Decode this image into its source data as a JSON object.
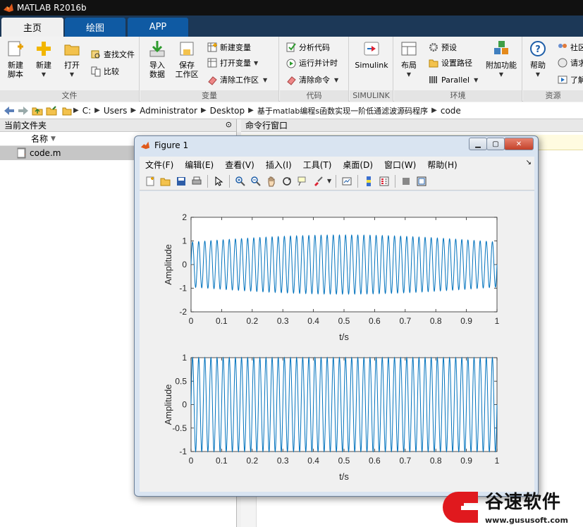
{
  "app": {
    "title": "MATLAB R2016b"
  },
  "tabs": [
    {
      "label": "主页"
    },
    {
      "label": "绘图"
    },
    {
      "label": "APP"
    }
  ],
  "ribbon": {
    "file": {
      "label": "文件",
      "new_script": "新建\n脚本",
      "new": "新建",
      "open": "打开",
      "find_files": "查找文件",
      "compare": "比较"
    },
    "variable": {
      "label": "变量",
      "import": "导入\n数据",
      "save": "保存\n工作区",
      "new_var": "新建变量",
      "open_var": "打开变量",
      "clear_ws": "清除工作区"
    },
    "code": {
      "label": "代码",
      "analyze": "分析代码",
      "run_time": "运行并计时",
      "clear_cmd": "清除命令"
    },
    "simulink": {
      "label": "SIMULINK",
      "simulink": "Simulink"
    },
    "env": {
      "label": "环境",
      "layout": "布局",
      "prefs": "预设",
      "set_path": "设置路径",
      "parallel": "Parallel",
      "addons": "附加功能"
    },
    "res": {
      "label": "资源",
      "help": "帮助",
      "community": "社区",
      "request": "请求",
      "learn": "了解"
    }
  },
  "address": {
    "crumbs": [
      "C:",
      "Users",
      "Administrator",
      "Desktop",
      "基于matlab编程s函数实现一阶低通滤波源码程序",
      "code"
    ]
  },
  "left_panel": {
    "title": "当前文件夹",
    "col_name": "名称",
    "files": [
      {
        "name": "code.m"
      }
    ]
  },
  "right_panel": {
    "title": "命令行窗口"
  },
  "figure": {
    "title": "Figure 1",
    "menu": [
      "文件(F)",
      "编辑(E)",
      "查看(V)",
      "插入(I)",
      "工具(T)",
      "桌面(D)",
      "窗口(W)",
      "帮助(H)"
    ]
  },
  "chart_data": [
    {
      "type": "line",
      "title": "",
      "xlabel": "t/s",
      "ylabel": "Amplitude",
      "xlim": [
        0,
        1
      ],
      "ylim": [
        -2,
        2
      ],
      "xticks": [
        0,
        0.1,
        0.2,
        0.3,
        0.4,
        0.5,
        0.6,
        0.7,
        0.8,
        0.9,
        1
      ],
      "yticks": [
        -2,
        -1,
        0,
        1,
        2
      ],
      "series": [
        {
          "color": "#0072bd",
          "frequency_hz": 50,
          "amplitude": 1.0,
          "envelope_peak": 1.25,
          "envelope_period_s": 1.0
        }
      ],
      "grid": false
    },
    {
      "type": "line",
      "title": "",
      "xlabel": "t/s",
      "ylabel": "Amplitude",
      "xlim": [
        0,
        1
      ],
      "ylim": [
        -1,
        1
      ],
      "xticks": [
        0,
        0.1,
        0.2,
        0.3,
        0.4,
        0.5,
        0.6,
        0.7,
        0.8,
        0.9,
        1
      ],
      "yticks": [
        -1,
        -0.5,
        0,
        0.5,
        1
      ],
      "series": [
        {
          "color": "#0072bd",
          "frequency_hz": 50,
          "amplitude": 1.0
        }
      ],
      "grid": false
    }
  ],
  "watermark": {
    "brand": "谷速软件",
    "url": "www.gususoft.com"
  }
}
